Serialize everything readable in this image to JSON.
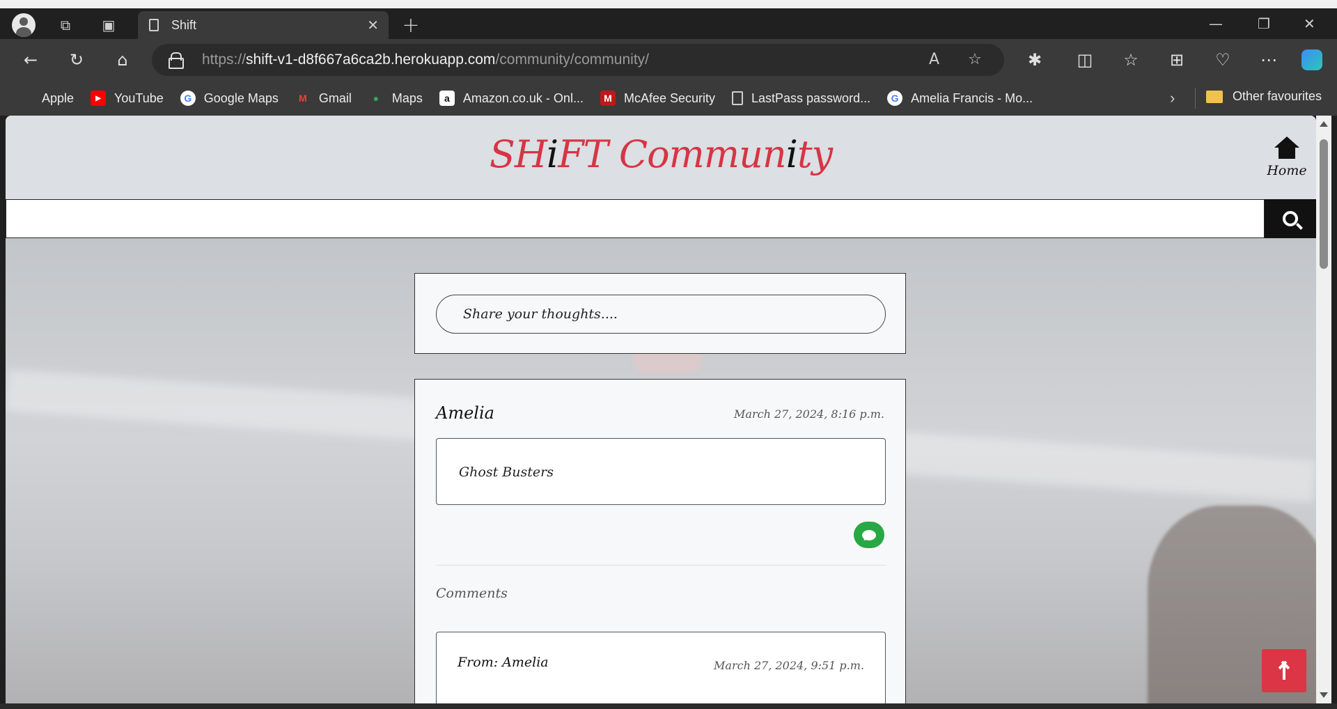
{
  "browser": {
    "tab_title": "Shift",
    "url_prefix": "https://",
    "url_host": "shift-v1-d8f667a6ca2b.herokuapp.com",
    "url_path": "/community/community/",
    "bookmarks": [
      {
        "label": "Apple",
        "icon": "apple-icon",
        "color": "#cfcfcf"
      },
      {
        "label": "YouTube",
        "icon": "youtube-icon",
        "color": "#ff0000"
      },
      {
        "label": "Google Maps",
        "icon": "google-icon",
        "color": "#ffffff"
      },
      {
        "label": "Gmail",
        "icon": "gmail-icon",
        "color": "#ea4335"
      },
      {
        "label": "Maps",
        "icon": "maps-pin-icon",
        "color": "#34a853"
      },
      {
        "label": "Amazon.co.uk - Onl...",
        "icon": "amazon-icon",
        "color": "#ffffff"
      },
      {
        "label": "McAfee Security",
        "icon": "mcafee-icon",
        "color": "#c01818"
      },
      {
        "label": "LastPass password...",
        "icon": "page-icon",
        "color": "#cfcfcf"
      },
      {
        "label": "Amelia Francis - Mo...",
        "icon": "google-icon",
        "color": "#ffffff"
      }
    ],
    "other_favourites": "Other favourites"
  },
  "site": {
    "brand_parts": [
      "SH",
      "i",
      "FT Commun",
      "i",
      "ty"
    ],
    "brand_color": "#d63545",
    "home_label": "Home",
    "search_value": ""
  },
  "share": {
    "placeholder": "Share your thoughts...."
  },
  "post": {
    "author": "Amelia",
    "date": "March 27, 2024, 8:16 p.m.",
    "body": "Ghost Busters",
    "comments_heading": "Comments",
    "comment": {
      "from": "From: Amelia",
      "date": "March 27, 2024, 9:51 p.m."
    }
  },
  "colors": {
    "comment_button": "#28a745",
    "back_to_top": "#dc3545"
  }
}
